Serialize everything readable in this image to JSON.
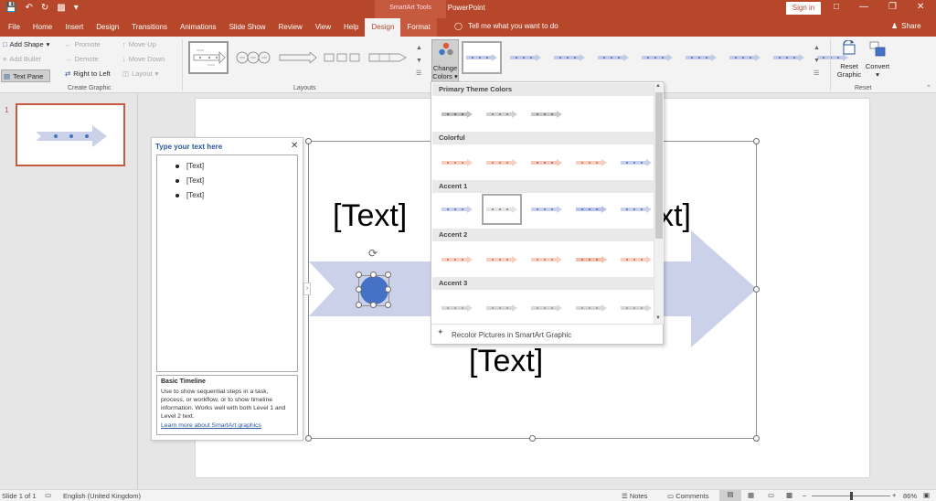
{
  "title_bar": {
    "title": "Presentation1 - PowerPoint",
    "contextual_group": "SmartArt Tools",
    "sign_in": "Sign in"
  },
  "tabs": [
    {
      "label": "File"
    },
    {
      "label": "Home"
    },
    {
      "label": "Insert"
    },
    {
      "label": "Design"
    },
    {
      "label": "Transitions"
    },
    {
      "label": "Animations"
    },
    {
      "label": "Slide Show"
    },
    {
      "label": "Review"
    },
    {
      "label": "View"
    },
    {
      "label": "Help"
    },
    {
      "label": "Design"
    },
    {
      "label": "Format"
    }
  ],
  "tell_me": "Tell me what you want to do",
  "share": "Share",
  "ribbon": {
    "create_graphic": {
      "add_shape": "Add Shape",
      "add_bullet": "Add Bullet",
      "text_pane": "Text Pane",
      "promote": "Promote",
      "demote": "Demote",
      "right_to_left": "Right to Left",
      "move_up": "Move Up",
      "move_down": "Move Down",
      "layout": "Layout",
      "label": "Create Graphic"
    },
    "layouts_label": "Layouts",
    "change_colors": [
      "Change",
      "Colors"
    ],
    "reset": {
      "reset_graphic": [
        "Reset",
        "Graphic"
      ],
      "convert": "Convert",
      "label": "Reset"
    }
  },
  "slide_panel": {
    "number": "1"
  },
  "text_pane": {
    "title": "Type your text here",
    "bullets": [
      "[Text]",
      "[Text]",
      "[Text]"
    ],
    "desc_title": "Basic Timeline",
    "desc_body": "Use to show sequential steps in a task, process, or workflow, or to show timeline information. Works well with both Level 1 and Level 2 text.",
    "desc_link": "Learn more about SmartArt graphics"
  },
  "smartart": {
    "text_top_left": "[Text]",
    "text_top_right": "[Text]",
    "text_bottom": "[Text]",
    "arrow_color": "#ccd1ea",
    "node_color": "#4472c4"
  },
  "color_gallery": {
    "sections": [
      {
        "name": "Primary Theme Colors"
      },
      {
        "name": "Colorful"
      },
      {
        "name": "Accent 1"
      },
      {
        "name": "Accent 2"
      },
      {
        "name": "Accent 3"
      }
    ],
    "footer": "Recolor Pictures in SmartArt Graphic"
  },
  "status_bar": {
    "slide": "Slide 1 of 1",
    "language": "English (United Kingdom)",
    "notes": "Notes",
    "comments": "Comments",
    "zoom": "86%"
  }
}
